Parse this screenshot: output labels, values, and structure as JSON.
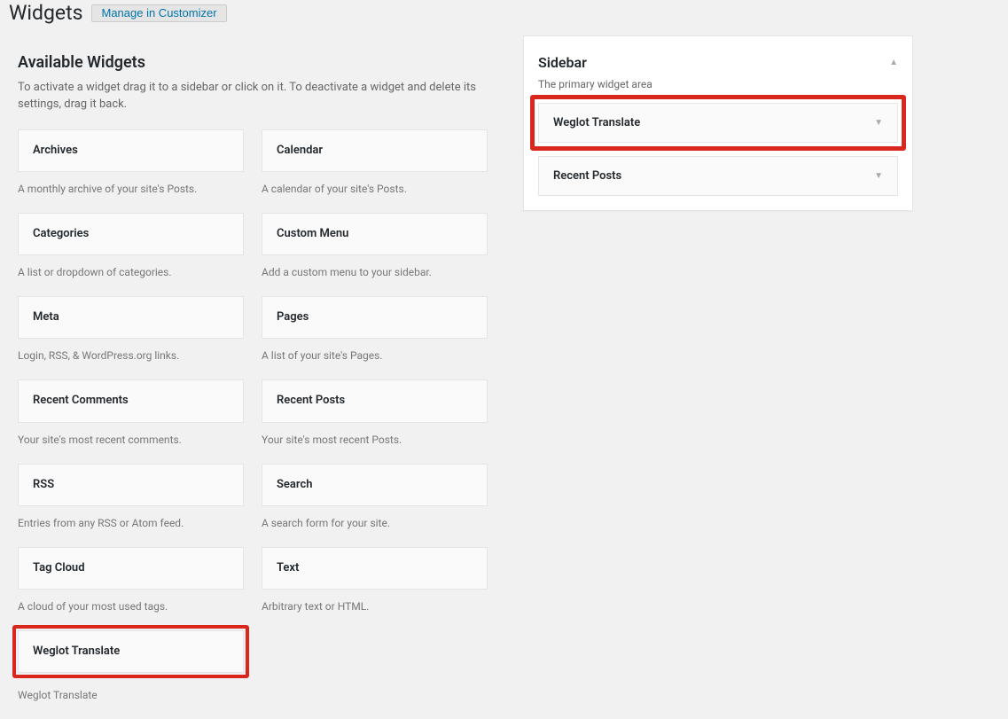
{
  "header": {
    "title": "Widgets",
    "customizer_btn": "Manage in Customizer"
  },
  "available": {
    "title": "Available Widgets",
    "description": "To activate a widget drag it to a sidebar or click on it. To deactivate a widget and delete its settings, drag it back."
  },
  "widgets": [
    {
      "name": "Archives",
      "desc": "A monthly archive of your site's Posts."
    },
    {
      "name": "Calendar",
      "desc": "A calendar of your site's Posts."
    },
    {
      "name": "Categories",
      "desc": "A list or dropdown of categories."
    },
    {
      "name": "Custom Menu",
      "desc": "Add a custom menu to your sidebar."
    },
    {
      "name": "Meta",
      "desc": "Login, RSS, & WordPress.org links."
    },
    {
      "name": "Pages",
      "desc": "A list of your site's Pages."
    },
    {
      "name": "Recent Comments",
      "desc": "Your site's most recent comments."
    },
    {
      "name": "Recent Posts",
      "desc": "Your site's most recent Posts."
    },
    {
      "name": "RSS",
      "desc": "Entries from any RSS or Atom feed."
    },
    {
      "name": "Search",
      "desc": "A search form for your site."
    },
    {
      "name": "Tag Cloud",
      "desc": "A cloud of your most used tags."
    },
    {
      "name": "Text",
      "desc": "Arbitrary text or HTML."
    },
    {
      "name": "Weglot Translate",
      "desc": "Weglot Translate"
    }
  ],
  "sidebar": {
    "title": "Sidebar",
    "desc": "The primary widget area",
    "items": [
      {
        "name": "Weglot Translate"
      },
      {
        "name": "Recent Posts"
      }
    ]
  }
}
